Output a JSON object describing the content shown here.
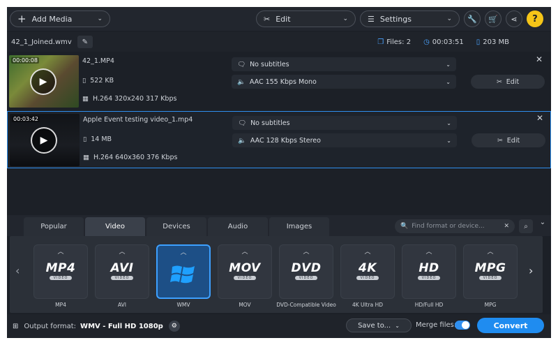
{
  "toolbar": {
    "add_media": "Add Media",
    "edit": "Edit",
    "settings": "Settings"
  },
  "infobar": {
    "filename": "42_1_Joined.wmv",
    "files": "Files: 2",
    "duration": "00:03:51",
    "size": "203 MB"
  },
  "files": [
    {
      "duration": "00:00:08",
      "name": "42_1.MP4",
      "size": "522 KB",
      "codec": "H.264 320x240 317 Kbps",
      "subtitles": "No subtitles",
      "audio": "AAC 155 Kbps Mono",
      "edit": "Edit"
    },
    {
      "duration": "00:03:42",
      "name": "Apple Event testing video_1.mp4",
      "size": "14 MB",
      "codec": "H.264 640x360 376 Kbps",
      "subtitles": "No subtitles",
      "audio": "AAC 128 Kbps Stereo",
      "edit": "Edit"
    }
  ],
  "tabs": [
    "Popular",
    "Video",
    "Devices",
    "Audio",
    "Images"
  ],
  "active_tab": "Video",
  "search": {
    "placeholder": "Find format or device..."
  },
  "formats": [
    {
      "logo": "MP4",
      "sub": "VIDEO",
      "label": "MP4"
    },
    {
      "logo": "AVI",
      "sub": "VIDEO",
      "label": "AVI"
    },
    {
      "logo": "",
      "sub": "",
      "label": "WMV"
    },
    {
      "logo": "MOV",
      "sub": "VIDEO",
      "label": "MOV"
    },
    {
      "logo": "DVD",
      "sub": "VIDEO",
      "label": "DVD-Compatible Video"
    },
    {
      "logo": "4K",
      "sub": "VIDEO",
      "label": "4K Ultra HD"
    },
    {
      "logo": "HD",
      "sub": "VIDEO",
      "label": "HD/Full HD"
    },
    {
      "logo": "MPG",
      "sub": "VIDEO",
      "label": "MPG"
    }
  ],
  "selected_format": "WMV",
  "bottom": {
    "output_label": "Output format:",
    "output_value": "WMV - Full HD 1080p",
    "save_to": "Save to...",
    "merge_label": "Merge files:",
    "merge_on": true,
    "convert": "Convert"
  },
  "colors": {
    "accent": "#1f8cf0",
    "selected_border": "#2f8ff0",
    "help": "#f5c518"
  }
}
